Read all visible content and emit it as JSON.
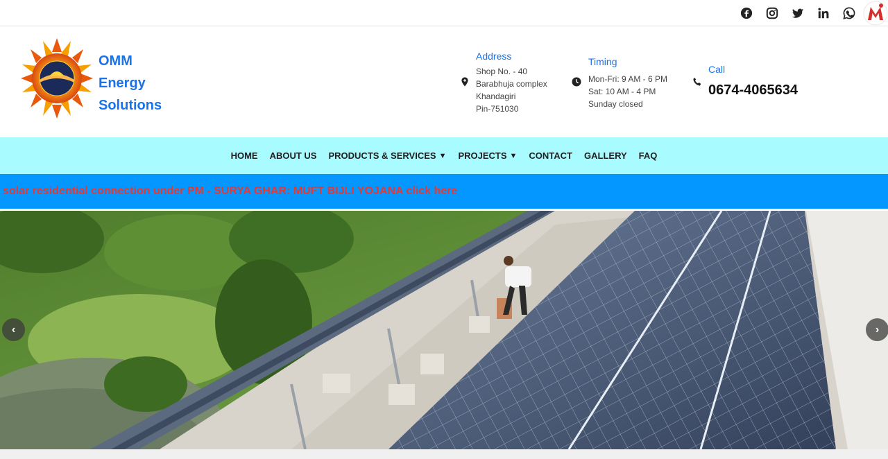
{
  "social": {
    "icons": [
      "facebook-icon",
      "instagram-icon",
      "twitter-icon",
      "linkedin-icon",
      "whatsapp-icon",
      "brand-m-icon"
    ]
  },
  "brand": {
    "line1": "OMM",
    "line2": "Energy",
    "line3": "Solutions"
  },
  "address": {
    "title": "Address",
    "line1": "Shop No. - 40",
    "line2": "Barabhuja complex",
    "line3": "Khandagiri",
    "line4": "Pin-751030"
  },
  "timing": {
    "title": "Timing",
    "line1": "Mon-Fri: 9 AM - 6 PM",
    "line2": "Sat: 10 AM - 4 PM",
    "line3": "Sunday closed"
  },
  "call": {
    "title": "Call",
    "number": "0674-4065634"
  },
  "nav": {
    "home": "HOME",
    "about": "ABOUT US",
    "products": "PRODUCTS & SERVICES",
    "projects": "PROJECTS",
    "contact": "CONTACT",
    "gallery": "GALLERY",
    "faq": "FAQ",
    "caret": "▼"
  },
  "marquee": {
    "text": "solar residential connection under PM - SURYA GHAR: MUFT BIJLI YOJANA click here"
  },
  "slider": {
    "prev": "‹",
    "next": "›"
  },
  "colors": {
    "brand_blue": "#1a73e8",
    "nav_bg": "#a8fbff",
    "marquee_bg": "#0397ff",
    "marquee_text": "#e53935"
  }
}
